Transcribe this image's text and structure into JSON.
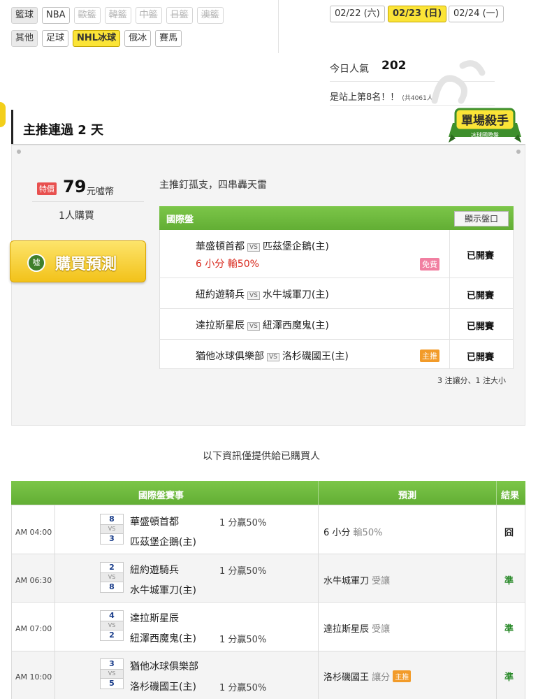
{
  "nav": {
    "row1": {
      "category": "籃球",
      "items": [
        {
          "label": "NBA",
          "state": "normal"
        },
        {
          "label": "歐籃",
          "state": "disabled"
        },
        {
          "label": "韓籃",
          "state": "disabled"
        },
        {
          "label": "中籃",
          "state": "disabled"
        },
        {
          "label": "日籃",
          "state": "disabled"
        },
        {
          "label": "澳籃",
          "state": "disabled"
        }
      ]
    },
    "row2": {
      "category": "其他",
      "items": [
        {
          "label": "足球",
          "state": "normal"
        },
        {
          "label": "NHL冰球",
          "state": "active"
        },
        {
          "label": "俄冰",
          "state": "normal"
        },
        {
          "label": "賽馬",
          "state": "normal"
        }
      ]
    }
  },
  "dates": [
    {
      "label": "02/22 (六)",
      "active": false
    },
    {
      "label": "02/23 (日)",
      "active": true
    },
    {
      "label": "02/24 (一)",
      "active": false
    }
  ],
  "popularity": {
    "label": "今日人氣",
    "value": "202",
    "rank_text": "是站上第8名！！",
    "rank_note": "(共4061人)"
  },
  "main": {
    "title": "主推連過 2 天",
    "badge_line1": "單場殺手",
    "badge_line2": "冰球國際盤",
    "price_tag": "特價",
    "price": "79",
    "price_unit": "元噓幣",
    "buyers": "1人購買",
    "buy_button": "購買預測",
    "buy_coin": "噓",
    "slogan": "主推釘孤支，四串轟天雷",
    "pick_header": "國際盤",
    "show_button": "顯示盤口",
    "picks": [
      {
        "away": "華盛頓首都",
        "home": "匹茲堡企鵝(主)",
        "note": "6 小分  輸50%",
        "tag": "免費",
        "status": "已開賽"
      },
      {
        "away": "紐約遊騎兵",
        "home": "水牛城軍刀(主)",
        "note": "",
        "tag": "",
        "status": "已開賽"
      },
      {
        "away": "達拉斯星辰",
        "home": "紐澤西魔鬼(主)",
        "note": "",
        "tag": "",
        "status": "已開賽"
      },
      {
        "away": "猶他冰球俱樂部",
        "home": "洛杉磯國王(主)",
        "note": "",
        "tag": "主推",
        "status": "已開賽"
      }
    ],
    "summary": "3 注讓分、1 注大小",
    "vs_label": "VS"
  },
  "info_note": "以下資訊僅提供給已購買人",
  "results": {
    "headers": [
      "國際盤賽事",
      "預測",
      "結果"
    ],
    "rows": [
      {
        "time": "AM 04:00",
        "away_score": "8",
        "home_score": "3",
        "away": "華盛頓首都",
        "home": "匹茲堡企鵝(主)",
        "odds": "1 分贏50%",
        "odds_row": "away",
        "predict_main": "6 小分",
        "predict_sub": "輸50%",
        "predict_tag": "",
        "result": "囧",
        "result_type": "lose"
      },
      {
        "time": "AM 06:30",
        "away_score": "2",
        "home_score": "8",
        "away": "紐約遊騎兵",
        "home": "水牛城軍刀(主)",
        "odds": "1 分贏50%",
        "odds_row": "away",
        "predict_main": "水牛城軍刀",
        "predict_sub": "受讓",
        "predict_tag": "",
        "result": "準",
        "result_type": "win"
      },
      {
        "time": "AM 07:00",
        "away_score": "4",
        "home_score": "2",
        "away": "達拉斯星辰",
        "home": "紐澤西魔鬼(主)",
        "odds": "1 分贏50%",
        "odds_row": "home",
        "predict_main": "達拉斯星辰",
        "predict_sub": "受讓",
        "predict_tag": "",
        "result": "準",
        "result_type": "win"
      },
      {
        "time": "AM 10:00",
        "away_score": "3",
        "home_score": "5",
        "away": "猶他冰球俱樂部",
        "home": "洛杉磯國王(主)",
        "odds": "1 分贏50%",
        "odds_row": "home",
        "predict_main": "洛杉磯國王",
        "predict_sub": "讓分",
        "predict_tag": "主推",
        "result": "準",
        "result_type": "win"
      }
    ],
    "vs_label": "VS"
  }
}
